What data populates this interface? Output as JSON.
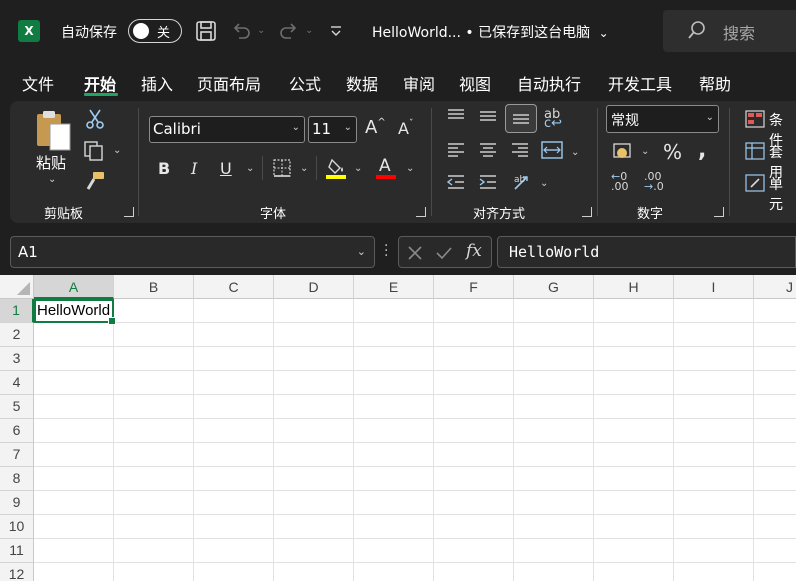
{
  "titlebar": {
    "autosave_label": "自动保存",
    "autosave_state": "关",
    "doc_title": "HelloWorld...  •  已保存到这台电脑",
    "search_placeholder": "搜索",
    "logo_letter": "X"
  },
  "menu": {
    "tabs": [
      "文件",
      "开始",
      "插入",
      "页面布局",
      "公式",
      "数据",
      "审阅",
      "视图",
      "自动执行",
      "开发工具",
      "帮助"
    ],
    "active_index": 1
  },
  "ribbon": {
    "clipboard": {
      "label": "剪贴板",
      "paste_label": "粘贴"
    },
    "font": {
      "label": "字体",
      "font_name": "Calibri",
      "font_size": "11",
      "bold": "B",
      "italic": "I",
      "underline": "U",
      "color_letter": "A"
    },
    "alignment": {
      "label": "对齐方式"
    },
    "number": {
      "label": "数字",
      "format": "常规"
    },
    "styles": {
      "items": [
        "条件",
        "套用",
        "单元"
      ]
    }
  },
  "formula_bar": {
    "name_box": "A1",
    "fx": "fx",
    "content": "HelloWorld"
  },
  "grid": {
    "columns": [
      "A",
      "B",
      "C",
      "D",
      "E",
      "F",
      "G",
      "H",
      "I",
      "J"
    ],
    "rows": [
      "1",
      "2",
      "3",
      "4",
      "5",
      "6",
      "7",
      "8",
      "9",
      "10",
      "11",
      "12"
    ],
    "selected_cell": "A1",
    "cell_A1": "HelloWorld"
  },
  "colors": {
    "accent": "#107c41",
    "highlight_yellow": "#ffff00",
    "font_red": "#ff0000",
    "titlebar": "#1f1f1f",
    "ribbon": "#2b2b2b"
  }
}
